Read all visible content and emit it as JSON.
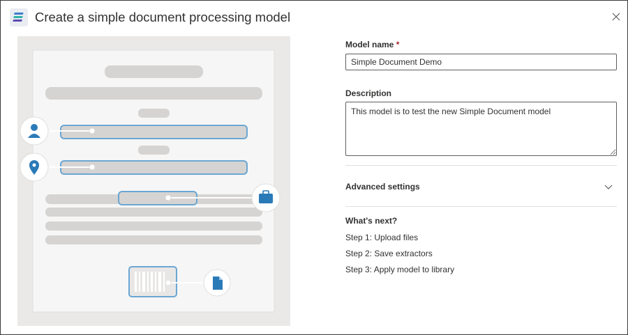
{
  "header": {
    "title": "Create a simple document processing model",
    "app_icon": "stacked-layers-icon",
    "close_icon": "close-icon"
  },
  "form": {
    "model_name_label": "Model name",
    "required_marker": "*",
    "model_name_value": "Simple Document Demo",
    "description_label": "Description",
    "description_value": "This model is to test the new Simple Document model",
    "advanced_settings_label": "Advanced settings",
    "advanced_settings_icon": "chevron-down-icon"
  },
  "whats_next": {
    "title": "What's next?",
    "steps": [
      "Step 1: Upload files",
      "Step 2: Save extractors",
      "Step 3: Apply model to library"
    ]
  },
  "illustration": {
    "icons": [
      "person-icon",
      "location-pin-icon",
      "briefcase-icon",
      "barcode-icon",
      "document-icon"
    ]
  },
  "colors": {
    "accent": "#2a7ab8",
    "highlight_border": "#6ba6d3",
    "placeholder_bar": "#d6d4d2",
    "page_background": "#f6f6f6",
    "illustration_background": "#eae9e8",
    "text": "#323130",
    "required": "#a4262c"
  }
}
